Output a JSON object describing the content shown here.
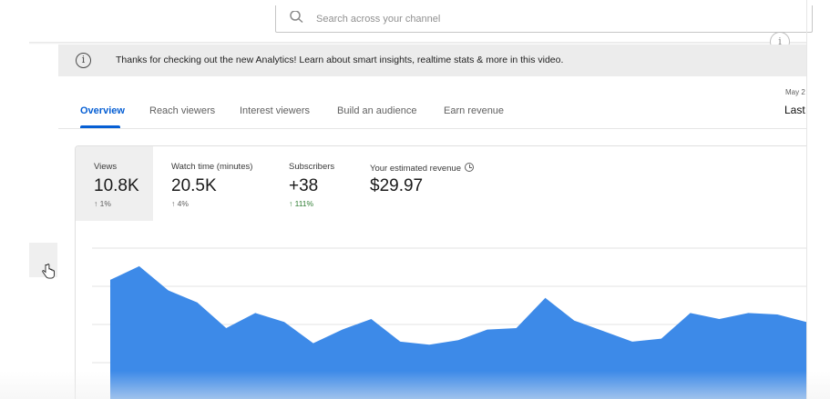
{
  "search": {
    "placeholder": "Search across your channel"
  },
  "banner": {
    "text": "Thanks for checking out the new Analytics! Learn about smart insights, realtime stats & more in this video."
  },
  "tabs": [
    {
      "label": "Overview",
      "active": true
    },
    {
      "label": "Reach viewers",
      "active": false
    },
    {
      "label": "Interest viewers",
      "active": false
    },
    {
      "label": "Build an audience",
      "active": false
    },
    {
      "label": "Earn revenue",
      "active": false
    }
  ],
  "date": {
    "small": "May 2",
    "range": "Last"
  },
  "metrics": [
    {
      "label": "Views",
      "value": "10.8K",
      "delta": "↑ 1%",
      "selected": true
    },
    {
      "label": "Watch time (minutes)",
      "value": "20.5K",
      "delta": "↑ 4%",
      "selected": false
    },
    {
      "label": "Subscribers",
      "value": "+38",
      "delta": "↑ 111%",
      "selected": false
    },
    {
      "label": "Your estimated revenue",
      "value": "$29.97",
      "delta": "",
      "selected": false
    }
  ],
  "colors": {
    "accent": "#065fd4",
    "chart_fill": "#3d8ae8",
    "positive": "#2e7d32"
  },
  "chart_data": {
    "type": "area",
    "series": [
      {
        "values": [
          0.79,
          0.88,
          0.72,
          0.64,
          0.47,
          0.57,
          0.51,
          0.37,
          0.46,
          0.53,
          0.38,
          0.36,
          0.39,
          0.46,
          0.47,
          0.67,
          0.52,
          0.45,
          0.38,
          0.4,
          0.57,
          0.53,
          0.57,
          0.56,
          0.51
        ]
      }
    ],
    "ylim": [
      0,
      1
    ],
    "grid": true
  }
}
